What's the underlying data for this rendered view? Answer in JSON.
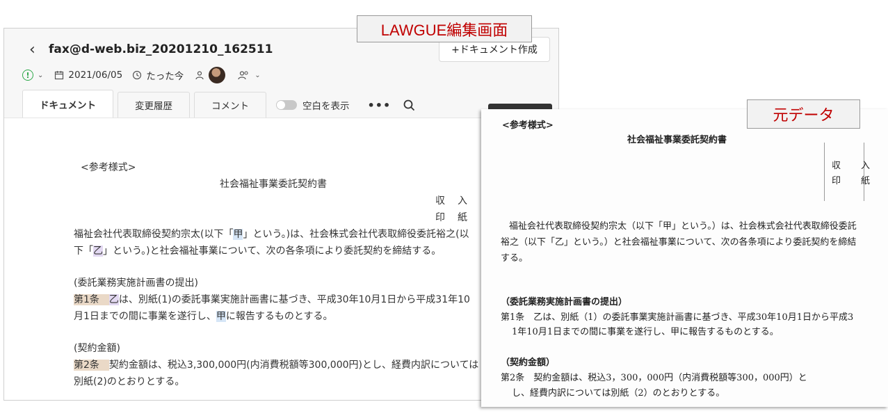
{
  "labels": {
    "editor": "LAWGUE編集画面",
    "original": "元データ"
  },
  "editor": {
    "back_icon": "chevron-left-icon",
    "title": "fax@d-web.biz_20201210_162511",
    "new_doc_button": "+ドキュメント作成",
    "meta": {
      "status_icon": "exclamation-circle-icon",
      "date": "2021/06/05",
      "time_ago": "たった今"
    },
    "tabs": [
      {
        "label": "ドキュメント"
      },
      {
        "label": "変更履歴"
      },
      {
        "label": "コメント"
      }
    ],
    "toggle_label": "空白を表示",
    "more": "•••",
    "body": {
      "ref_heading": "<参考様式>",
      "doc_title": "社会福祉事業委託契約書",
      "stamp_1": "収　入",
      "stamp_2": "印　紙",
      "l1_a": "福祉会社代表取締役契約宗太(以下「",
      "l1_kou": "甲",
      "l1_b": "」という。)は、社会株式会社代表取締役委託裕之(以",
      "l2_a": "下「",
      "l2_otsu": "乙",
      "l2_b": "」という。)と社会福祉事業について、次の各条項により委託契約を締結する。",
      "sec1_heading": "(委託業務実施計画書の提出)",
      "a1_num": "第1条　",
      "a1_otsu": "乙",
      "a1_rest": "は、別紙(1)の委託事業実施計画書に基づき、平成30年10月1日から平成31年10",
      "a1_l2_a": "月1日までの間に事業を遂行し、",
      "a1_kou": "甲",
      "a1_l2_b": "に報告するものとする。",
      "sec2_heading": "(契約金額)",
      "a2_num": "第2条　",
      "a2_rest": "契約金額は、税込3,300,000円(内消費税額等300,000円)とし、経費内訳については",
      "a2_l2": "別紙(2)のとおりとする。"
    }
  },
  "original": {
    "ref_heading": "<参考様式>",
    "doc_title": "社会福祉事業委託契約書",
    "stamp_1": "収　入",
    "stamp_2": "印　紙",
    "p1_l1": "福祉会社代表取締役契約宗太（以下「甲」という。）は、社会株式会社代表取締役委託",
    "p1_l2": "裕之（以下「乙」という。）と社会福祉事業について、次の各条項により委託契約を締結",
    "p1_l3": "する。",
    "sec1_heading": "（委託業務実施計画書の提出）",
    "a1_l1": "第1条　乙は、別紙（1）の委託事業実施計画書に基づき、平成30年10月1日から平成3",
    "a1_l2": "1年10月1日までの間に事業を遂行し、甲に報告するものとする。",
    "sec2_heading": "（契約金額）",
    "a2_l1": "第2条　契約金額は、税込3，300，000円（内消費税額等300，000円）と",
    "a2_l2": "し、経費内訳については別紙（2）のとおりとする。"
  }
}
